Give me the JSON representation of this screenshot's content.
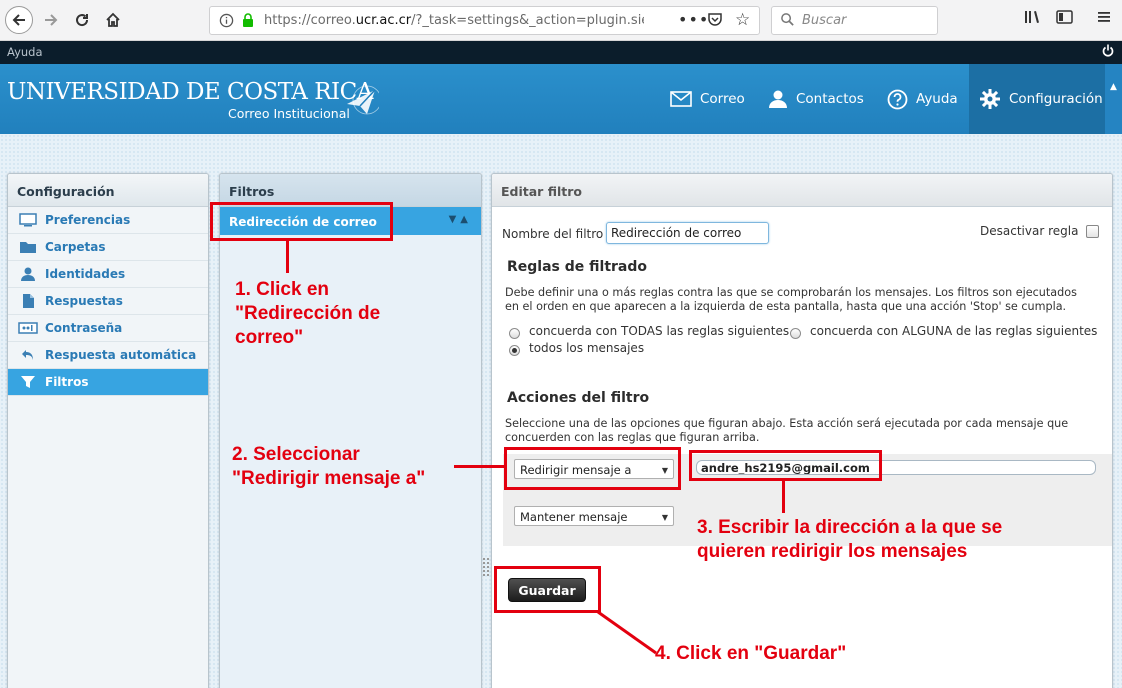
{
  "browser": {
    "url_prefix": "https://correo.",
    "url_domain": "ucr.ac.cr",
    "url_suffix": "/?_task=settings&_action=plugin.sievei",
    "more": "•••",
    "search_placeholder": "Buscar"
  },
  "topline": {
    "help": "Ayuda"
  },
  "header": {
    "logo_main": "UNIVERSIDAD DE COSTA RICA",
    "logo_sub": "Correo Institucional",
    "nav": [
      {
        "label": "Correo",
        "icon": "envelope-icon"
      },
      {
        "label": "Contactos",
        "icon": "person-icon"
      },
      {
        "label": "Ayuda",
        "icon": "question-icon"
      },
      {
        "label": "Configuración",
        "icon": "gear-icon"
      }
    ],
    "accent": "#2b90cc"
  },
  "settings": {
    "title": "Configuración",
    "items": [
      {
        "label": "Preferencias",
        "icon": "monitor-icon"
      },
      {
        "label": "Carpetas",
        "icon": "folder-icon"
      },
      {
        "label": "Identidades",
        "icon": "user-icon"
      },
      {
        "label": "Respuestas",
        "icon": "document-icon"
      },
      {
        "label": "Contraseña",
        "icon": "password-icon"
      },
      {
        "label": "Respuesta automática",
        "icon": "reply-icon"
      },
      {
        "label": "Filtros",
        "icon": "filter-icon"
      }
    ],
    "selected": "Filtros"
  },
  "filters": {
    "title": "Filtros",
    "items": [
      {
        "label": "Redirección de correo"
      }
    ]
  },
  "edit": {
    "title": "Editar filtro",
    "name_label": "Nombre del filtro",
    "name_value": "Redirección de correo",
    "disable_label": "Desactivar regla",
    "rules_heading": "Reglas de filtrado",
    "rules_desc_1": "Debe definir una o más reglas contra las que se comprobarán los mensajes. Los filtros son ejecutados",
    "rules_desc_2": "en el orden en que aparecen a la izquierda de esta pantalla, hasta que una acción 'Stop' se cumpla.",
    "radio_all": "concuerda con TODAS las reglas siguientes",
    "radio_any": "concuerda con ALGUNA de las reglas siguientes",
    "radio_every": "todos los mensajes",
    "radio_selected": "todos los mensajes",
    "actions_heading": "Acciones del filtro",
    "actions_desc_1": "Seleccione una de las opciones que figuran abajo. Esta acción será ejecutada por cada mensaje que",
    "actions_desc_2": "concuerden con las reglas que figuran arriba.",
    "action1_select": "Redirigir mensaje a",
    "action1_value": "andre_hs2195@gmail.com",
    "action2_select": "Mantener mensaje",
    "save_label": "Guardar"
  },
  "annotations": {
    "step1": "1. Click en\n\"Redirección de\ncorreo\"",
    "step2": "2. Seleccionar\n\"Redirigir mensaje a\"",
    "step3": "3. Escribir la dirección a la que se\nquieren redirigir los mensajes",
    "step4": "4. Click en \"Guardar\"",
    "color": "#e3000f"
  }
}
